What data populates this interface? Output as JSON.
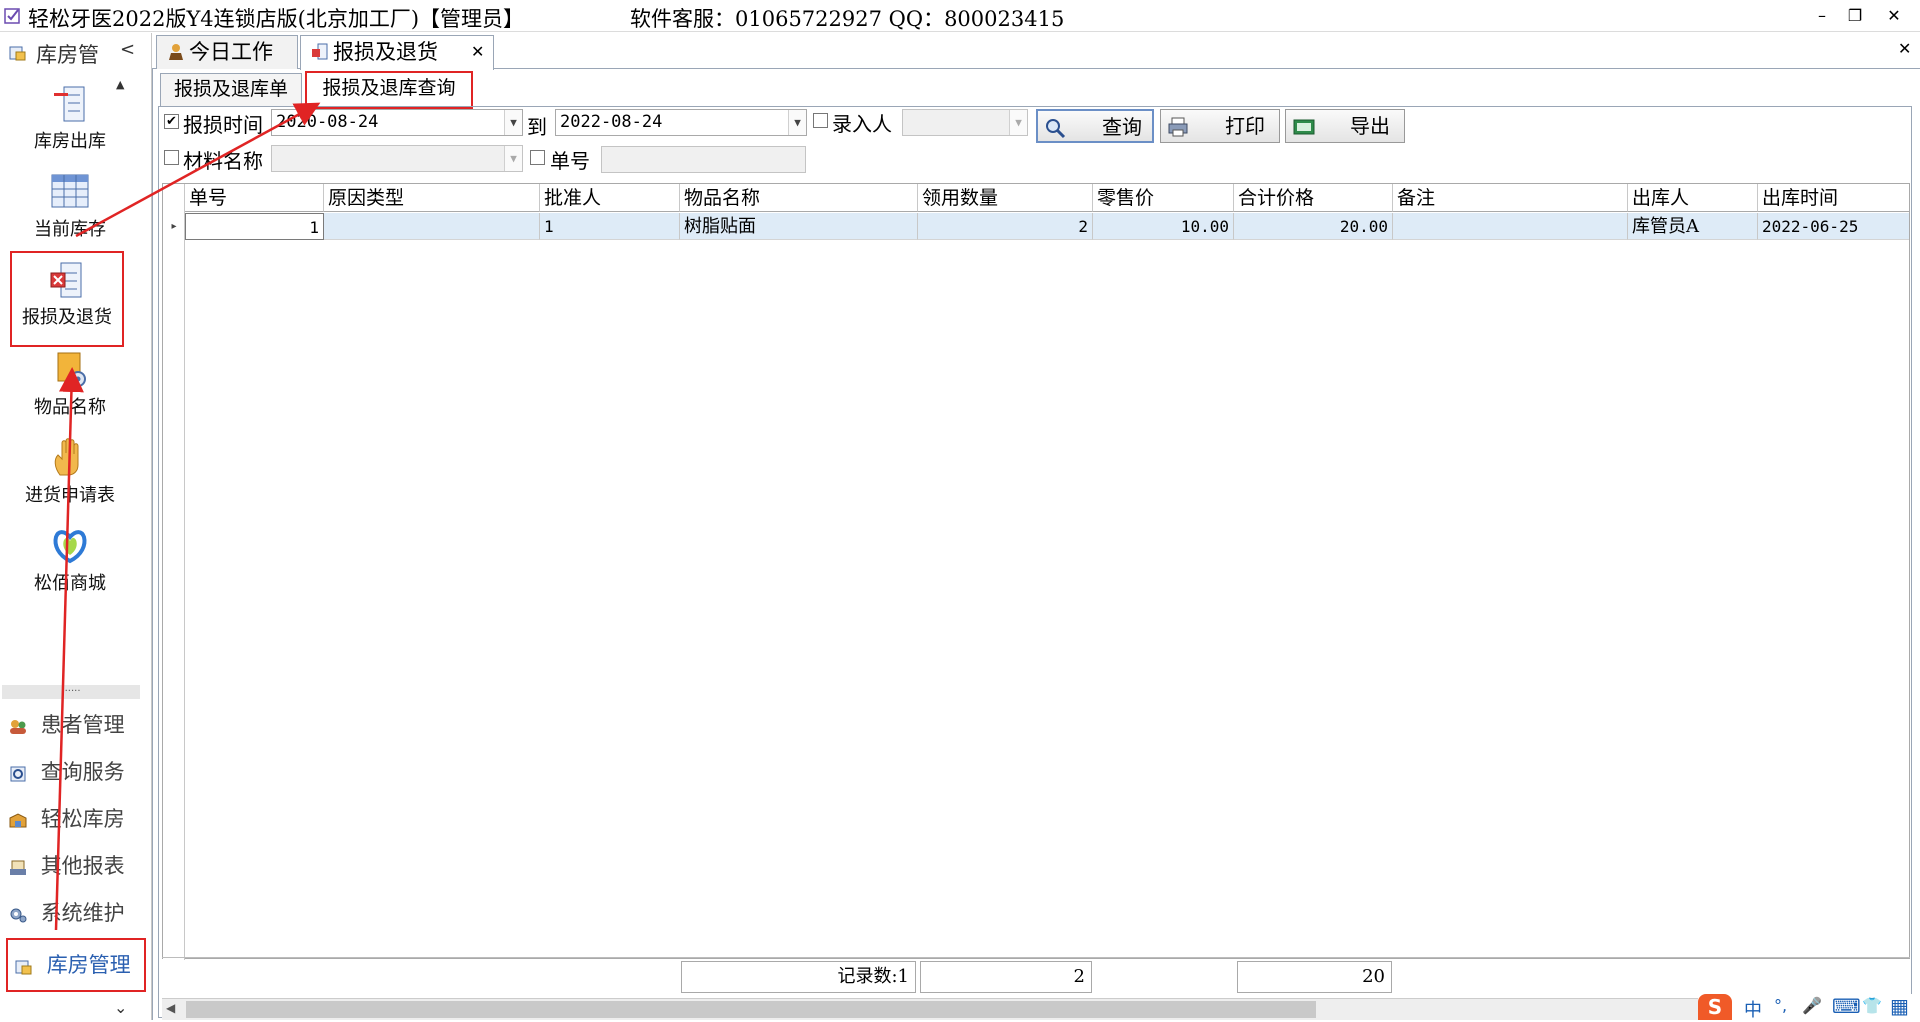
{
  "titlebar": {
    "app_title": "轻松牙医2022版Y4连锁店版(北京加工厂)【管理员】",
    "support": "软件客服：01065722927 QQ：800023415",
    "min": "–",
    "restore": "❐",
    "close": "✕"
  },
  "sidebar": {
    "header": "库房管",
    "header_arrow": "<",
    "scroll_up": "▲",
    "scroll_down": "⌄",
    "splitter": "......",
    "items": [
      {
        "label": "库房出库",
        "icon": "outbound-icon"
      },
      {
        "label": "当前库存",
        "icon": "grid-icon"
      },
      {
        "label": "报损及退货",
        "icon": "damage-return-icon"
      },
      {
        "label": "物品名称",
        "icon": "item-settings-icon"
      },
      {
        "label": "进货申请表",
        "icon": "hand-icon"
      },
      {
        "label": "松佰商城",
        "icon": "mall-icon"
      }
    ],
    "modules": [
      {
        "label": "患者管理",
        "icon": "patients-icon"
      },
      {
        "label": "查询服务",
        "icon": "query-icon"
      },
      {
        "label": "轻松库房",
        "icon": "warehouse-icon"
      },
      {
        "label": "其他报表",
        "icon": "report-icon"
      },
      {
        "label": "系统维护",
        "icon": "gear-icon"
      },
      {
        "label": "库房管理",
        "icon": "storage-mgmt-icon"
      }
    ]
  },
  "tabs": {
    "items": [
      "今日工作",
      "报损及退货"
    ],
    "close": "✕",
    "panel_close": "✕"
  },
  "subtabs": [
    "报损及退库单",
    "报损及退库查询"
  ],
  "filters": {
    "date_label": "报损时间",
    "date_checked": "✔",
    "date_from": "2020-08-24",
    "to_label": "到",
    "date_to": "2022-08-24",
    "entry_label": "录入人",
    "entry_value": "",
    "material_label": "材料名称",
    "material_value": "",
    "order_label": "单号",
    "order_value": "",
    "query_button": "查询",
    "print_button": "打印",
    "export_button": "导出"
  },
  "grid": {
    "columns": [
      "单号",
      "原因类型",
      "批准人",
      "物品名称",
      "领用数量",
      "零售价",
      "合计价格",
      "备注",
      "出库人",
      "出库时间"
    ],
    "rows": [
      {
        "marker": "▸",
        "order_no": "1",
        "reason": "",
        "approver": "1",
        "item": "树脂贴面",
        "qty": "2",
        "price": "10.00",
        "total": "20.00",
        "note": "",
        "issuer": "库管员A",
        "time": "2022-06-25"
      }
    ]
  },
  "summary": {
    "count": "记录数:1",
    "qty_total": "2",
    "price_total": "20"
  },
  "taskbar": {
    "ime_logo": "S",
    "ime_lang": "中",
    "ime_punct": "°,",
    "ime_mic": "🎤",
    "ime_keyboard": "⌨",
    "ime_shirt": "👕",
    "ime_grid": "▦"
  },
  "colors": {
    "annotation_red": "#e02424",
    "selected_row": "#deebf7"
  }
}
